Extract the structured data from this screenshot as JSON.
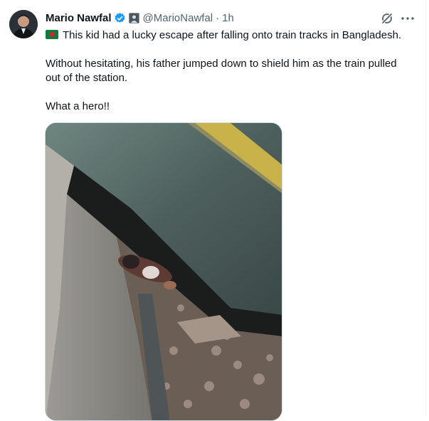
{
  "post": {
    "author_name": "Mario Nawfal",
    "handle": "@MarioNawfal",
    "separator": "·",
    "time": "1h",
    "lines": [
      "This kid had a lucky escape after falling onto train tracks in Bangladesh.",
      "Without hesitating, his father jumped down to shield him as the train pulled",
      "out of the station.",
      "What a hero!!"
    ],
    "flag_emoji": "bangladesh-flag",
    "media_type": "video"
  },
  "icons": {
    "verified": "verified-badge-icon",
    "affiliate": "affiliate-badge-icon",
    "grok": "grok-icon",
    "more": "more-options-icon"
  },
  "colors": {
    "text": "#0f1419",
    "secondary": "#536471",
    "verified": "#1d9bf0",
    "flag_green": "#0a7d3e",
    "flag_red": "#d81f2a"
  }
}
